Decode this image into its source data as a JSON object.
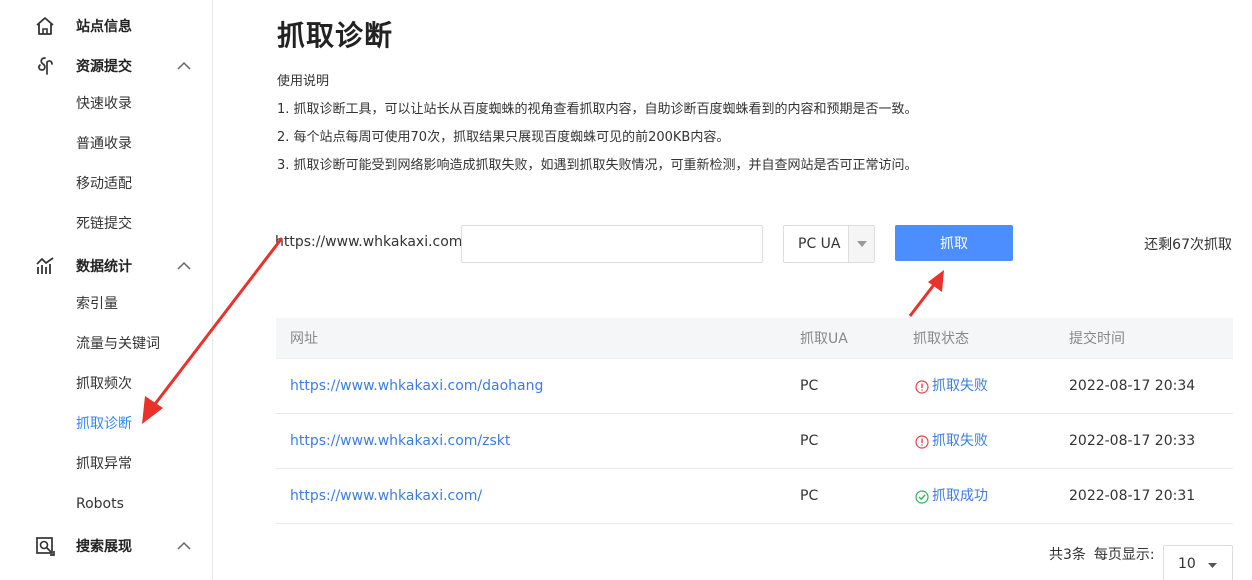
{
  "sidebar": {
    "sections": [
      {
        "label": "站点信息",
        "icon": "home-icon"
      },
      {
        "label": "资源提交",
        "icon": "submit-icon"
      },
      {
        "label": "数据统计",
        "icon": "stats-icon"
      },
      {
        "label": "搜索展现",
        "icon": "search-display-icon"
      }
    ],
    "items": [
      {
        "label": "快速收录"
      },
      {
        "label": "普通收录"
      },
      {
        "label": "移动适配"
      },
      {
        "label": "死链提交"
      },
      {
        "label": "索引量"
      },
      {
        "label": "流量与关键词"
      },
      {
        "label": "抓取频次"
      },
      {
        "label": "抓取诊断"
      },
      {
        "label": "抓取异常"
      },
      {
        "label": "Robots"
      }
    ]
  },
  "main": {
    "title": "抓取诊断",
    "usage_title": "使用说明",
    "notes": [
      "1. 抓取诊断工具，可以让站长从百度蜘蛛的视角查看抓取内容，自助诊断百度蜘蛛看到的内容和预期是否一致。",
      "2. 每个站点每周可使用70次，抓取结果只展现百度蜘蛛可见的前200KB内容。",
      "3. 抓取诊断可能受到网络影响造成抓取失败，如遇到抓取失败情况，可重新检测，并自查网站是否可正常访问。"
    ],
    "url_prefix": "https://www.whkakaxi.com/",
    "url_input_value": "",
    "ua_selected": "PC UA",
    "fetch_button": "抓取",
    "remaining": "还剩67次抓取"
  },
  "table": {
    "headers": [
      "网址",
      "抓取UA",
      "抓取状态",
      "提交时间"
    ],
    "rows": [
      {
        "url": "https://www.whkakaxi.com/daohang",
        "ua": "PC",
        "status": "抓取失败",
        "status_type": "fail",
        "time": "2022-08-17 20:34"
      },
      {
        "url": "https://www.whkakaxi.com/zskt",
        "ua": "PC",
        "status": "抓取失败",
        "status_type": "fail",
        "time": "2022-08-17 20:33"
      },
      {
        "url": "https://www.whkakaxi.com/",
        "ua": "PC",
        "status": "抓取成功",
        "status_type": "success",
        "time": "2022-08-17 20:31"
      }
    ]
  },
  "pager": {
    "total": "共3条",
    "per_page_label": "每页显示:",
    "per_page_value": "10"
  },
  "colors": {
    "accent": "#3385ff",
    "button": "#4c8eff",
    "fail": "#e64545",
    "success": "#2db55d",
    "annotation": "#e8322a"
  }
}
